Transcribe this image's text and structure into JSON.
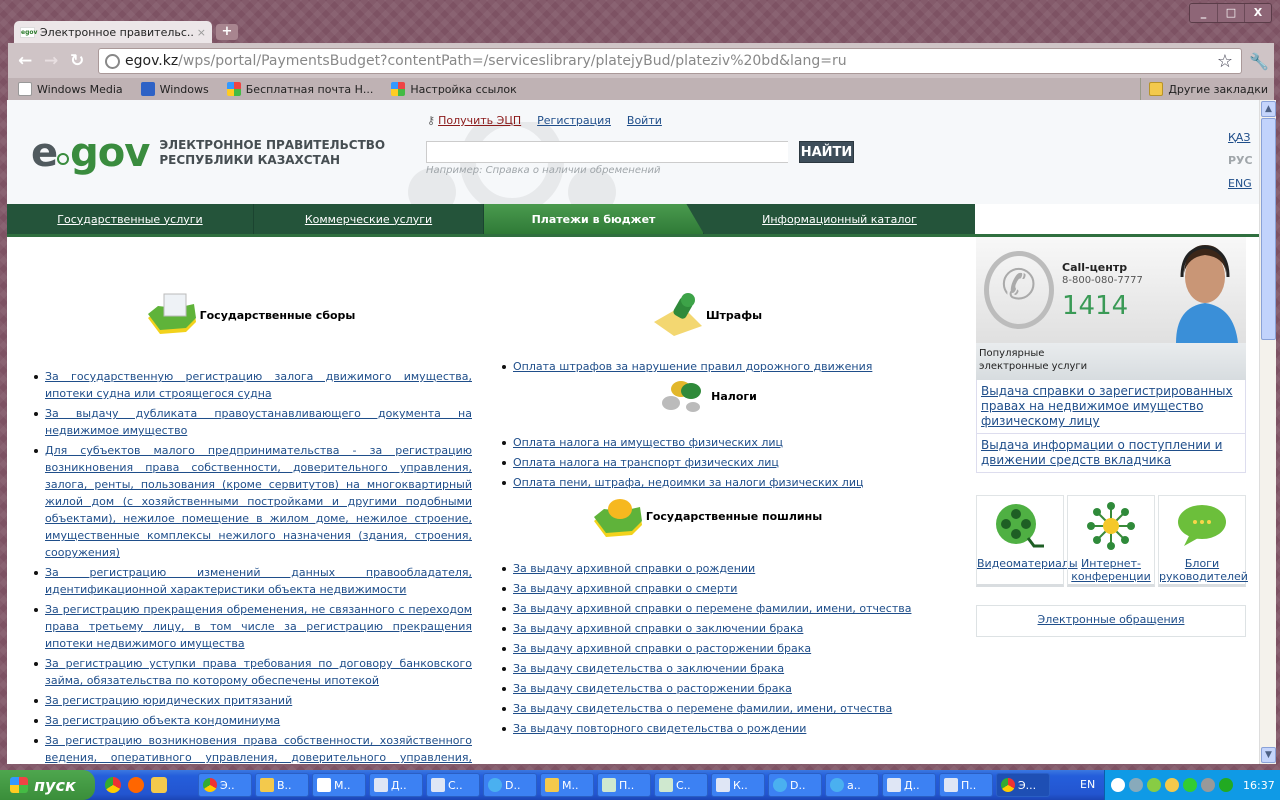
{
  "browser": {
    "tab_title": "Электронное правительс...",
    "tab_favicon": "egov",
    "url_host": "egov.kz",
    "url_path": "/wps/portal/PaymentsBudget?contentPath=/serviceslibrary/platejyBud/plateziv%20bd&lang=ru",
    "bookmarks": [
      "Windows Media",
      "Windows",
      "Бесплатная почта Н...",
      "Настройка ссылок"
    ],
    "other_bookmarks": "Другие закладки",
    "window_buttons": [
      "_",
      "□",
      "X"
    ]
  },
  "header": {
    "logo_e": "e",
    "logo_gov": "gov",
    "logo_line1": "ЭЛЕКТРОННОЕ ПРАВИТЕЛЬСТВО",
    "logo_line2": "РЕСПУБЛИКИ КАЗАХСТАН",
    "get_ecp": "Получить ЭЦП",
    "register": "Регистрация",
    "login": "Войти",
    "search_value": "",
    "search_button": "НАЙТИ",
    "search_hint": "Например: Справка о наличии обременений",
    "languages": [
      {
        "label": "ҚАЗ",
        "active": false
      },
      {
        "label": "РУС",
        "active": true
      },
      {
        "label": "ENG",
        "active": false
      }
    ]
  },
  "nav": [
    {
      "label": "Государственные услуги",
      "active": false
    },
    {
      "label": "Коммерческие услуги",
      "active": false
    },
    {
      "label": "Платежи в бюджет",
      "active": true
    },
    {
      "label": "Информационный каталог",
      "active": false
    }
  ],
  "sections": {
    "gos_sbory": {
      "title": "Государственные сборы",
      "icon": "kazakhstan-map-document-icon",
      "links": [
        "За государственную регистрацию залога движимого имущества, ипотеки судна или строящегося судна",
        "За выдачу дубликата правоустанавливающего документа на недвижимое имущество",
        "Для субъектов малого предпринимательства - за регистрацию возникновения права собственности, доверительного управления, залога, ренты, пользования (кроме сервитутов) на многоквартирный жилой дом (с хозяйственными постройками и другими подобными объектами), нежилое помещение в жилом доме, нежилое строение, имущественные комплексы нежилого назначения (здания, строения, сооружения)",
        "За регистрацию изменений данных правообладателя, идентификационной характеристики объекта недвижимости",
        "За регистрацию прекращения обременения, не связанного с переходом права третьему лицу, в том числе за регистрацию прекращения ипотеки недвижимого имущества",
        "За регистрацию уступки права требования по договору банковского займа, обязательства по которому обеспечены ипотекой",
        "За регистрацию юридических притязаний",
        "За регистрацию объекта кондоминиума",
        "За регистрацию возникновения права собственности, хозяйственного ведения, оперативного управления, доверительного управления, залога, ренты, пользования (кроме сервитутов) - на имущественные комплексы нежилого"
      ]
    },
    "shtrafy": {
      "title": "Штрафы",
      "icon": "stamp-icon",
      "links": [
        "Оплата штрафов за нарушение правил дорожного движения"
      ]
    },
    "nalogi": {
      "title": "Налоги",
      "icon": "coins-icon",
      "links": [
        "Оплата налога на имущество физических лиц",
        "Оплата налога на транспорт физических лиц",
        "Оплата пени, штрафа, недоимки за налоги физических лиц"
      ]
    },
    "poshliny": {
      "title": "Государственные пошлины",
      "icon": "kazakhstan-map-seal-icon",
      "links": [
        "За выдачу архивной справки о рождении",
        "За выдачу архивной справки о смерти",
        "За выдачу архивной справки о перемене фамилии, имени, отчества",
        "За выдачу архивной справки о заключении брака",
        "За выдачу архивной справки о расторжении брака",
        "За выдачу свидетельства о заключении брака",
        "За выдачу свидетельства о расторжении брака",
        "За выдачу свидетельства о перемене фамилии, имени, отчества",
        "За выдачу повторного свидетельства о рождении"
      ]
    }
  },
  "sidebar": {
    "call_title": "Call-центр",
    "call_phone": "8-800-080-7777",
    "call_short": "1414",
    "popular_title_1": "Популярные",
    "popular_title_2": "электронные услуги",
    "popular": [
      "Выдача справки о зарегистрированных правах на недвижимое имущество физическому лицу",
      "Выдача информации о поступлении и движении средств вкладчика"
    ],
    "tiles": [
      {
        "label": "Видеоматериалы",
        "icon": "film-reel-icon"
      },
      {
        "label": "Интернет-конференции",
        "icon": "network-icon"
      },
      {
        "label": "Блоги руководителей",
        "icon": "speech-bubble-icon"
      }
    ],
    "e_appeals": "Электронные обращения"
  },
  "taskbar": {
    "start": "пуск",
    "buttons": [
      "Э..",
      "В..",
      "М..",
      "Д..",
      "С..",
      "D..",
      "М..",
      "П..",
      "С..",
      "К..",
      "D..",
      "a..",
      "Д..",
      "П..",
      "Э..."
    ],
    "active_index": 14,
    "language": "EN",
    "clock": "16:37"
  }
}
